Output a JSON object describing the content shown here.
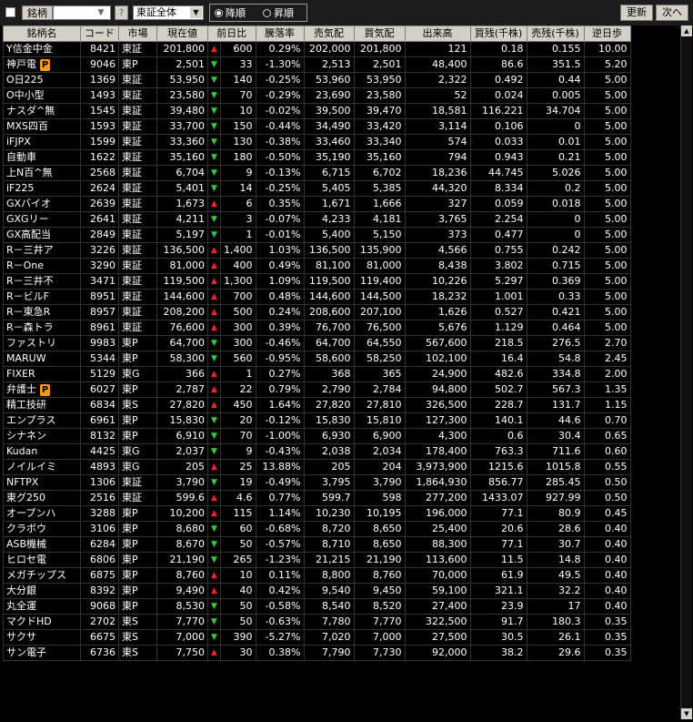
{
  "toolbar": {
    "symbol_label": "銘柄",
    "help_label": "?",
    "market_select": "東証全体",
    "sort_desc": "降順",
    "sort_asc": "昇順",
    "sort_selected": "desc",
    "refresh_label": "更新",
    "next_label": "次へ"
  },
  "columns": [
    "銘柄名",
    "コード",
    "市場",
    "現在値",
    "前日比",
    "",
    "騰落率",
    "売気配",
    "買気配",
    "出来高",
    "買残(千株)",
    "売残(千株)",
    "逆日歩"
  ],
  "rows": [
    {
      "name": "Y信金中金",
      "p": false,
      "code": "8421",
      "market": "東証",
      "price": "201,800",
      "dir": "up",
      "chg": "600",
      "pct": "0.29%",
      "ask": "202,000",
      "bid": "201,800",
      "vol": "121",
      "buy": "0.18",
      "sell": "0.155",
      "gyaku": "10.00"
    },
    {
      "name": "神戸電",
      "p": true,
      "code": "9046",
      "market": "東P",
      "price": "2,501",
      "dir": "dn",
      "chg": "33",
      "pct": "-1.30%",
      "ask": "2,513",
      "bid": "2,501",
      "vol": "48,400",
      "buy": "86.6",
      "sell": "351.5",
      "gyaku": "5.20"
    },
    {
      "name": "O日225",
      "p": false,
      "code": "1369",
      "market": "東証",
      "price": "53,950",
      "dir": "dn",
      "chg": "140",
      "pct": "-0.25%",
      "ask": "53,960",
      "bid": "53,950",
      "vol": "2,322",
      "buy": "0.492",
      "sell": "0.44",
      "gyaku": "5.00"
    },
    {
      "name": "O中小型",
      "p": false,
      "code": "1493",
      "market": "東証",
      "price": "23,580",
      "dir": "dn",
      "chg": "70",
      "pct": "-0.29%",
      "ask": "23,690",
      "bid": "23,580",
      "vol": "52",
      "buy": "0.024",
      "sell": "0.005",
      "gyaku": "5.00"
    },
    {
      "name": "ナスダ^無",
      "p": false,
      "code": "1545",
      "market": "東証",
      "price": "39,480",
      "dir": "dn",
      "chg": "10",
      "pct": "-0.02%",
      "ask": "39,500",
      "bid": "39,470",
      "vol": "18,581",
      "buy": "116.221",
      "sell": "34.704",
      "gyaku": "5.00"
    },
    {
      "name": "MXS四百",
      "p": false,
      "code": "1593",
      "market": "東証",
      "price": "33,700",
      "dir": "dn",
      "chg": "150",
      "pct": "-0.44%",
      "ask": "34,490",
      "bid": "33,420",
      "vol": "3,114",
      "buy": "0.106",
      "sell": "0",
      "gyaku": "5.00"
    },
    {
      "name": "iFJPX",
      "p": false,
      "code": "1599",
      "market": "東証",
      "price": "33,360",
      "dir": "dn",
      "chg": "130",
      "pct": "-0.38%",
      "ask": "33,460",
      "bid": "33,340",
      "vol": "574",
      "buy": "0.033",
      "sell": "0.01",
      "gyaku": "5.00"
    },
    {
      "name": "自動車",
      "p": false,
      "code": "1622",
      "market": "東証",
      "price": "35,160",
      "dir": "dn",
      "chg": "180",
      "pct": "-0.50%",
      "ask": "35,190",
      "bid": "35,160",
      "vol": "794",
      "buy": "0.943",
      "sell": "0.21",
      "gyaku": "5.00"
    },
    {
      "name": "上N百^無",
      "p": false,
      "code": "2568",
      "market": "東証",
      "price": "6,704",
      "dir": "dn",
      "chg": "9",
      "pct": "-0.13%",
      "ask": "6,715",
      "bid": "6,702",
      "vol": "18,236",
      "buy": "44.745",
      "sell": "5.026",
      "gyaku": "5.00"
    },
    {
      "name": "iF225",
      "p": false,
      "code": "2624",
      "market": "東証",
      "price": "5,401",
      "dir": "dn",
      "chg": "14",
      "pct": "-0.25%",
      "ask": "5,405",
      "bid": "5,385",
      "vol": "44,320",
      "buy": "8.334",
      "sell": "0.2",
      "gyaku": "5.00"
    },
    {
      "name": "GXバイオ",
      "p": false,
      "code": "2639",
      "market": "東証",
      "price": "1,673",
      "dir": "up",
      "chg": "6",
      "pct": "0.35%",
      "ask": "1,671",
      "bid": "1,666",
      "vol": "327",
      "buy": "0.059",
      "sell": "0.018",
      "gyaku": "5.00"
    },
    {
      "name": "GXGリー",
      "p": false,
      "code": "2641",
      "market": "東証",
      "price": "4,211",
      "dir": "dn",
      "chg": "3",
      "pct": "-0.07%",
      "ask": "4,233",
      "bid": "4,181",
      "vol": "3,765",
      "buy": "2.254",
      "sell": "0",
      "gyaku": "5.00"
    },
    {
      "name": "GX高配当",
      "p": false,
      "code": "2849",
      "market": "東証",
      "price": "5,197",
      "dir": "dn",
      "chg": "1",
      "pct": "-0.01%",
      "ask": "5,400",
      "bid": "5,150",
      "vol": "373",
      "buy": "0.477",
      "sell": "0",
      "gyaku": "5.00"
    },
    {
      "name": "R－三井ア",
      "p": false,
      "code": "3226",
      "market": "東証",
      "price": "136,500",
      "dir": "up",
      "chg": "1,400",
      "pct": "1.03%",
      "ask": "136,500",
      "bid": "135,900",
      "vol": "4,566",
      "buy": "0.755",
      "sell": "0.242",
      "gyaku": "5.00"
    },
    {
      "name": "R－One",
      "p": false,
      "code": "3290",
      "market": "東証",
      "price": "81,000",
      "dir": "up",
      "chg": "400",
      "pct": "0.49%",
      "ask": "81,100",
      "bid": "81,000",
      "vol": "8,438",
      "buy": "3.802",
      "sell": "0.715",
      "gyaku": "5.00"
    },
    {
      "name": "R－三井不",
      "p": false,
      "code": "3471",
      "market": "東証",
      "price": "119,500",
      "dir": "up",
      "chg": "1,300",
      "pct": "1.09%",
      "ask": "119,500",
      "bid": "119,400",
      "vol": "10,226",
      "buy": "5.297",
      "sell": "0.369",
      "gyaku": "5.00"
    },
    {
      "name": "R－ビルF",
      "p": false,
      "code": "8951",
      "market": "東証",
      "price": "144,600",
      "dir": "up",
      "chg": "700",
      "pct": "0.48%",
      "ask": "144,600",
      "bid": "144,500",
      "vol": "18,232",
      "buy": "1.001",
      "sell": "0.33",
      "gyaku": "5.00"
    },
    {
      "name": "R－東急R",
      "p": false,
      "code": "8957",
      "market": "東証",
      "price": "208,200",
      "dir": "up",
      "chg": "500",
      "pct": "0.24%",
      "ask": "208,600",
      "bid": "207,100",
      "vol": "1,626",
      "buy": "0.527",
      "sell": "0.421",
      "gyaku": "5.00"
    },
    {
      "name": "R－森トラ",
      "p": false,
      "code": "8961",
      "market": "東証",
      "price": "76,600",
      "dir": "up",
      "chg": "300",
      "pct": "0.39%",
      "ask": "76,700",
      "bid": "76,500",
      "vol": "5,676",
      "buy": "1.129",
      "sell": "0.464",
      "gyaku": "5.00"
    },
    {
      "name": "ファストリ",
      "p": false,
      "code": "9983",
      "market": "東P",
      "price": "64,700",
      "dir": "dn",
      "chg": "300",
      "pct": "-0.46%",
      "ask": "64,700",
      "bid": "64,550",
      "vol": "567,600",
      "buy": "218.5",
      "sell": "276.5",
      "gyaku": "2.70"
    },
    {
      "name": "MARUW",
      "p": false,
      "code": "5344",
      "market": "東P",
      "price": "58,300",
      "dir": "dn",
      "chg": "560",
      "pct": "-0.95%",
      "ask": "58,600",
      "bid": "58,250",
      "vol": "102,100",
      "buy": "16.4",
      "sell": "54.8",
      "gyaku": "2.45"
    },
    {
      "name": "FIXER",
      "p": false,
      "code": "5129",
      "market": "東G",
      "price": "366",
      "dir": "up",
      "chg": "1",
      "pct": "0.27%",
      "ask": "368",
      "bid": "365",
      "vol": "24,900",
      "buy": "482.6",
      "sell": "334.8",
      "gyaku": "2.00"
    },
    {
      "name": "弁護士",
      "p": true,
      "code": "6027",
      "market": "東P",
      "price": "2,787",
      "dir": "up",
      "chg": "22",
      "pct": "0.79%",
      "ask": "2,790",
      "bid": "2,784",
      "vol": "94,800",
      "buy": "502.7",
      "sell": "567.3",
      "gyaku": "1.35"
    },
    {
      "name": "精工技研",
      "p": false,
      "code": "6834",
      "market": "東S",
      "price": "27,820",
      "dir": "up",
      "chg": "450",
      "pct": "1.64%",
      "ask": "27,820",
      "bid": "27,810",
      "vol": "326,500",
      "buy": "228.7",
      "sell": "131.7",
      "gyaku": "1.15"
    },
    {
      "name": "エンプラス",
      "p": false,
      "code": "6961",
      "market": "東P",
      "price": "15,830",
      "dir": "dn",
      "chg": "20",
      "pct": "-0.12%",
      "ask": "15,830",
      "bid": "15,810",
      "vol": "127,300",
      "buy": "140.1",
      "sell": "44.6",
      "gyaku": "0.70"
    },
    {
      "name": "シナネン",
      "p": false,
      "code": "8132",
      "market": "東P",
      "price": "6,910",
      "dir": "dn",
      "chg": "70",
      "pct": "-1.00%",
      "ask": "6,930",
      "bid": "6,900",
      "vol": "4,300",
      "buy": "0.6",
      "sell": "30.4",
      "gyaku": "0.65"
    },
    {
      "name": "Kudan",
      "p": false,
      "code": "4425",
      "market": "東G",
      "price": "2,037",
      "dir": "dn",
      "chg": "9",
      "pct": "-0.43%",
      "ask": "2,038",
      "bid": "2,034",
      "vol": "178,400",
      "buy": "763.3",
      "sell": "711.6",
      "gyaku": "0.60"
    },
    {
      "name": "ノイルイミ",
      "p": false,
      "code": "4893",
      "market": "東G",
      "price": "205",
      "dir": "up",
      "chg": "25",
      "pct": "13.88%",
      "ask": "205",
      "bid": "204",
      "vol": "3,973,900",
      "buy": "1215.6",
      "sell": "1015.8",
      "gyaku": "0.55"
    },
    {
      "name": "NFTPX",
      "p": false,
      "code": "1306",
      "market": "東証",
      "price": "3,790",
      "dir": "dn",
      "chg": "19",
      "pct": "-0.49%",
      "ask": "3,795",
      "bid": "3,790",
      "vol": "1,864,930",
      "buy": "856.77",
      "sell": "285.45",
      "gyaku": "0.50"
    },
    {
      "name": "東グ250",
      "p": false,
      "code": "2516",
      "market": "東証",
      "price": "599.6",
      "dir": "up",
      "chg": "4.6",
      "pct": "0.77%",
      "ask": "599.7",
      "bid": "598",
      "vol": "277,200",
      "buy": "1433.07",
      "sell": "927.99",
      "gyaku": "0.50"
    },
    {
      "name": "オープンハ",
      "p": false,
      "code": "3288",
      "market": "東P",
      "price": "10,200",
      "dir": "up",
      "chg": "115",
      "pct": "1.14%",
      "ask": "10,230",
      "bid": "10,195",
      "vol": "196,000",
      "buy": "77.1",
      "sell": "80.9",
      "gyaku": "0.45"
    },
    {
      "name": "クラボウ",
      "p": false,
      "code": "3106",
      "market": "東P",
      "price": "8,680",
      "dir": "dn",
      "chg": "60",
      "pct": "-0.68%",
      "ask": "8,720",
      "bid": "8,650",
      "vol": "25,400",
      "buy": "20.6",
      "sell": "28.6",
      "gyaku": "0.40"
    },
    {
      "name": "ASB機械",
      "p": false,
      "code": "6284",
      "market": "東P",
      "price": "8,670",
      "dir": "dn",
      "chg": "50",
      "pct": "-0.57%",
      "ask": "8,710",
      "bid": "8,650",
      "vol": "88,300",
      "buy": "77.1",
      "sell": "30.7",
      "gyaku": "0.40"
    },
    {
      "name": "ヒロセ電",
      "p": false,
      "code": "6806",
      "market": "東P",
      "price": "21,190",
      "dir": "dn",
      "chg": "265",
      "pct": "-1.23%",
      "ask": "21,215",
      "bid": "21,190",
      "vol": "113,600",
      "buy": "11.5",
      "sell": "14.8",
      "gyaku": "0.40"
    },
    {
      "name": "メガチップス",
      "p": false,
      "code": "6875",
      "market": "東P",
      "price": "8,760",
      "dir": "up",
      "chg": "10",
      "pct": "0.11%",
      "ask": "8,800",
      "bid": "8,760",
      "vol": "70,000",
      "buy": "61.9",
      "sell": "49.5",
      "gyaku": "0.40"
    },
    {
      "name": "大分銀",
      "p": false,
      "code": "8392",
      "market": "東P",
      "price": "9,490",
      "dir": "up",
      "chg": "40",
      "pct": "0.42%",
      "ask": "9,540",
      "bid": "9,450",
      "vol": "59,100",
      "buy": "321.1",
      "sell": "32.2",
      "gyaku": "0.40"
    },
    {
      "name": "丸全運",
      "p": false,
      "code": "9068",
      "market": "東P",
      "price": "8,530",
      "dir": "dn",
      "chg": "50",
      "pct": "-0.58%",
      "ask": "8,540",
      "bid": "8,520",
      "vol": "27,400",
      "buy": "23.9",
      "sell": "17",
      "gyaku": "0.40"
    },
    {
      "name": "マクドHD",
      "p": false,
      "code": "2702",
      "market": "東S",
      "price": "7,770",
      "dir": "dn",
      "chg": "50",
      "pct": "-0.63%",
      "ask": "7,780",
      "bid": "7,770",
      "vol": "322,500",
      "buy": "91.7",
      "sell": "180.3",
      "gyaku": "0.35"
    },
    {
      "name": "サクサ",
      "p": false,
      "code": "6675",
      "market": "東S",
      "price": "7,000",
      "dir": "dn",
      "chg": "390",
      "pct": "-5.27%",
      "ask": "7,020",
      "bid": "7,000",
      "vol": "27,500",
      "buy": "30.5",
      "sell": "26.1",
      "gyaku": "0.35"
    },
    {
      "name": "サン電子",
      "p": false,
      "code": "6736",
      "market": "東S",
      "price": "7,750",
      "dir": "up",
      "chg": "30",
      "pct": "0.38%",
      "ask": "7,790",
      "bid": "7,730",
      "vol": "92,000",
      "buy": "38.2",
      "sell": "29.6",
      "gyaku": "0.35"
    }
  ],
  "colors": {
    "up": "#ff2020",
    "down": "#33cc33",
    "p_badge": "#ff9a00"
  }
}
